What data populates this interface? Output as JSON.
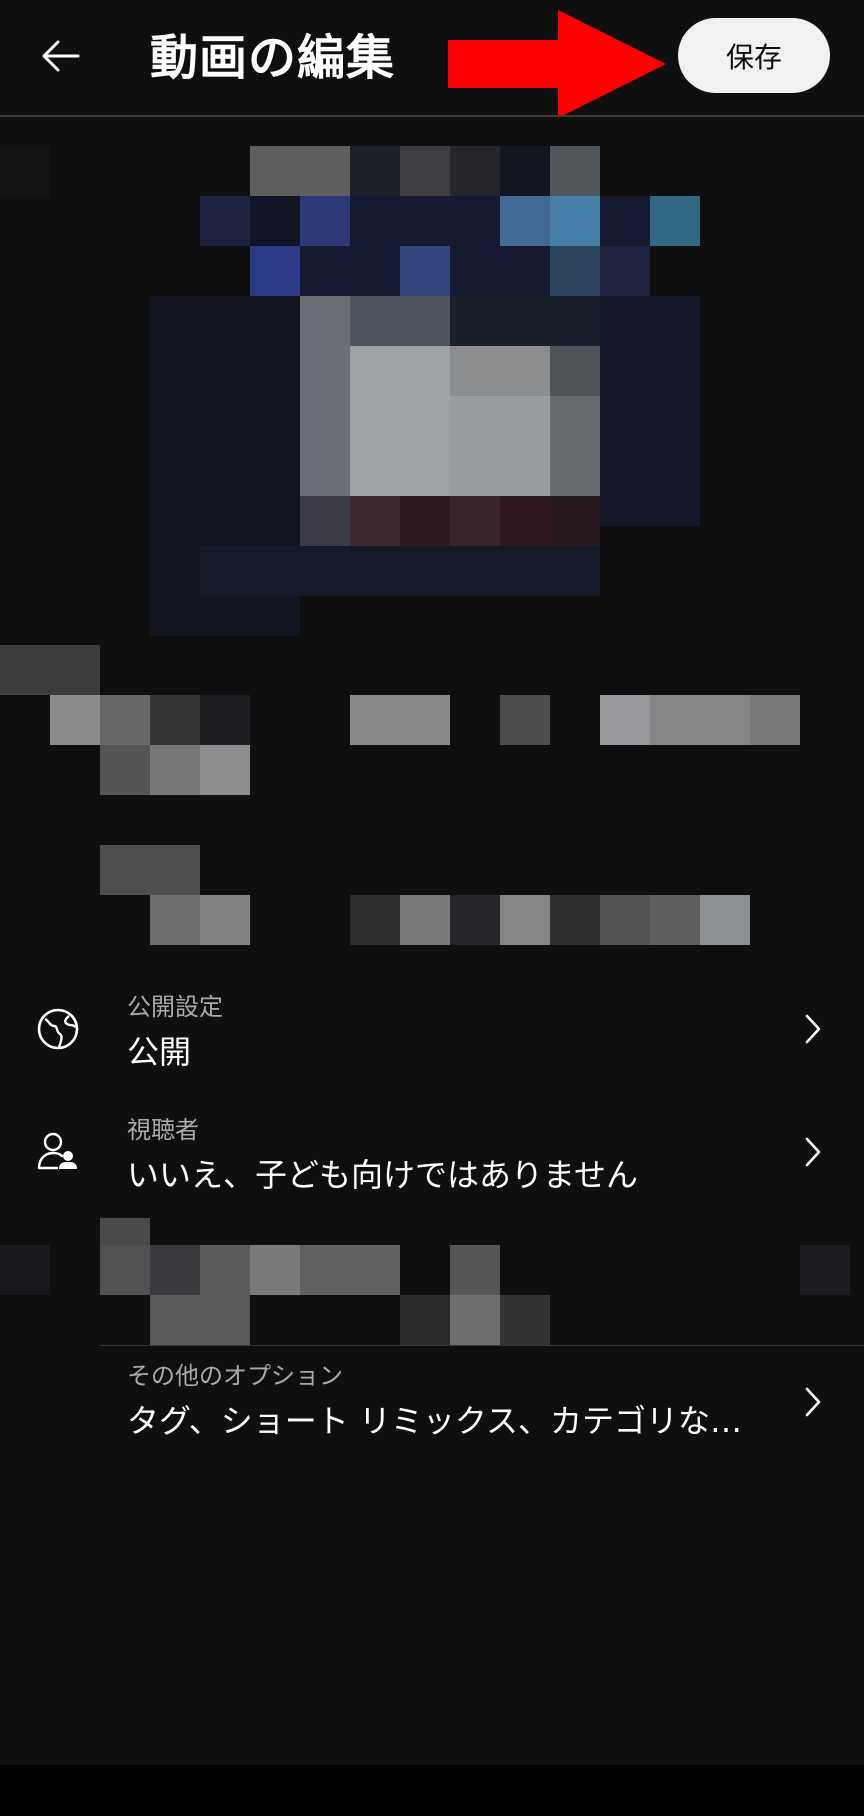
{
  "header": {
    "title": "動画の編集",
    "save_label": "保存",
    "back_icon": "arrow-left-icon",
    "annotation_arrow_color": "#ff0000"
  },
  "settings": [
    {
      "label": "公開設定",
      "value": "公開",
      "icon": "globe-icon"
    },
    {
      "label": "視聴者",
      "value": "いいえ、子ども向けではありません",
      "icon": "audience-icon"
    },
    {
      "label": "その他のオプション",
      "value": "タグ、ショート リミックス、カテゴリな…",
      "icon": "none"
    }
  ],
  "colors": {
    "background": "#0f0f0f",
    "save_button_bg": "#f1f1f1",
    "secondary_text": "#aaaaaa"
  }
}
